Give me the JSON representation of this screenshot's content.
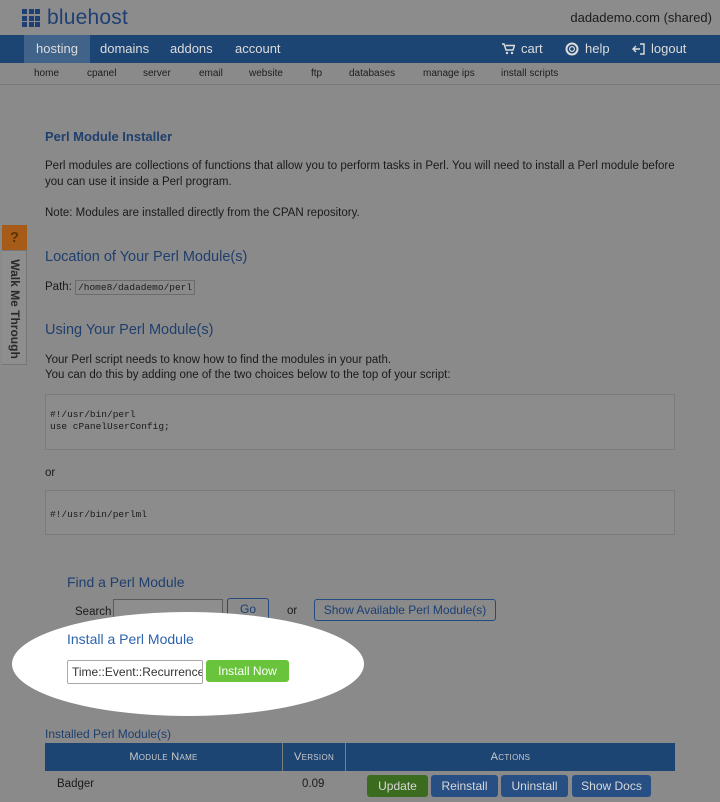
{
  "brand": {
    "name": "bluehost"
  },
  "account": {
    "name": "dadademo.com (shared)"
  },
  "nav": {
    "items": [
      "hosting",
      "domains",
      "addons",
      "account"
    ],
    "right": {
      "cart": "cart",
      "help": "help",
      "logout": "logout"
    }
  },
  "subnav": [
    "home",
    "cpanel",
    "server",
    "email",
    "website",
    "ftp",
    "databases",
    "manage ips",
    "install scripts"
  ],
  "page": {
    "title": "Perl Module Installer",
    "intro_line1": "Perl modules are collections of functions that allow you to perform tasks in Perl. You will need to install a Perl module before",
    "intro_line2": "you can use it inside a Perl program.",
    "note": "Note: Modules are installed directly from the CPAN repository.",
    "location_title": "Location of Your Perl Module(s)",
    "path_label": "Path:",
    "path_value": "/home8/dadademo/perl",
    "using_title": "Using Your Perl Module(s)",
    "using_line1": "Your Perl script needs to know how to find the modules in your path.",
    "using_line2": "You can do this by adding one of the two choices below to the top of your script:",
    "code1_line1": "#!/usr/bin/perl",
    "code1_line2": "use cPanelUserConfig;",
    "or_text": "or",
    "code2_line1": "#!/usr/bin/perlml"
  },
  "find": {
    "title": "Find a Perl Module",
    "search_label": "Search",
    "go_label": "Go",
    "or_text": "or",
    "show_label": "Show Available Perl Module(s)"
  },
  "install": {
    "title": "Install a Perl Module",
    "input_value": "Time::Event::Recurrence",
    "button_label": "Install Now"
  },
  "walk_me": {
    "q": "?",
    "label": "Walk Me Through"
  },
  "installed": {
    "title": "Installed Perl Module(s)",
    "headers": {
      "module": "Module Name",
      "version": "Version",
      "actions": "Actions"
    },
    "rows": [
      {
        "name": "Badger",
        "version": "0.09",
        "actions": [
          "Update",
          "Reinstall",
          "Uninstall",
          "Show Docs"
        ]
      }
    ]
  },
  "colors": {
    "nav": "#1d4573",
    "install_button": "#69c43c",
    "link": "#2d63ad"
  }
}
